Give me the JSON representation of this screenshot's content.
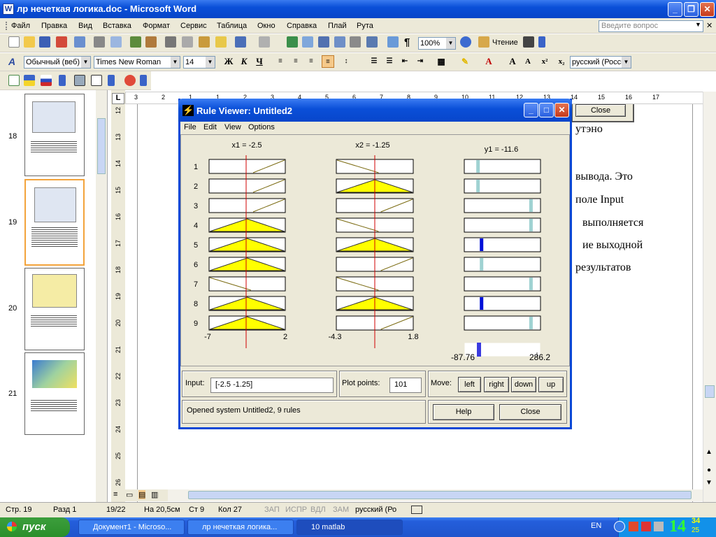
{
  "window": {
    "title": "лр нечеткая логика.doc - Microsoft Word"
  },
  "menu": [
    "Файл",
    "Правка",
    "Вид",
    "Вставка",
    "Формат",
    "Сервис",
    "Таблица",
    "Окно",
    "Справка",
    "Плай",
    "Рута"
  ],
  "search_placeholder": "Введите вопрос",
  "toolbar": {
    "zoom": "100%",
    "read_label": "Чтение",
    "style": "Обычный (веб)",
    "font": "Times New Roman",
    "size": "14",
    "lang": "русский (Росси"
  },
  "thumbnails": [
    "18",
    "19",
    "20",
    "21"
  ],
  "ruler_h_labels": [
    "3",
    "2",
    "1",
    "1",
    "2",
    "3",
    "4",
    "5",
    "6",
    "7",
    "8",
    "9",
    "10",
    "11",
    "12",
    "13",
    "14",
    "15",
    "16",
    "17"
  ],
  "ruler_v_labels": [
    "12",
    "13",
    "14",
    "15",
    "16",
    "17",
    "18",
    "19",
    "20",
    "21",
    "22",
    "23",
    "24",
    "25",
    "26"
  ],
  "doc_lines": [
    "утэно",
    "вывода. Это",
    "поле Input",
    "выполняется",
    "ие выходной",
    "результатов"
  ],
  "doc_close_label": "Close",
  "rule_viewer": {
    "title": "Rule Viewer: Untitled2",
    "menu": [
      "File",
      "Edit",
      "View",
      "Options"
    ],
    "col_titles": [
      "x1 = -2.5",
      "x2 = -1.25",
      "y1 = -11.6"
    ],
    "rule_numbers": [
      "1",
      "2",
      "3",
      "4",
      "5",
      "6",
      "7",
      "8",
      "9"
    ],
    "x1_range": [
      "-7",
      "2"
    ],
    "x2_range": [
      "-4.3",
      "1.8"
    ],
    "y_range": [
      "-87.76",
      "286.2"
    ],
    "input_label": "Input:",
    "input_value": "[-2.5 -1.25]",
    "plot_points_label": "Plot points:",
    "plot_points_value": "101",
    "move_label": "Move:",
    "move_buttons": [
      "left",
      "right",
      "down",
      "up"
    ],
    "status": "Opened system Untitled2, 9 rules",
    "help_label": "Help",
    "close_label": "Close"
  },
  "status_bar": {
    "page": "Стр. 19",
    "section": "Разд 1",
    "pages": "19/22",
    "at": "На 20,5см",
    "line": "Ст 9",
    "col": "Кол 27",
    "rec": "ЗАП",
    "trk": "ИСПР",
    "ext": "ВДЛ",
    "ovr": "ЗАМ",
    "lang": "русский (Ро"
  },
  "taskbar": {
    "start": "пуск",
    "tasks": [
      "Документ1 - Microso...",
      "лр нечеткая логика...",
      "10 matlab"
    ],
    "lang": "EN",
    "clock": "14",
    "clock_min": "34",
    "clock_sec": "25"
  },
  "colors": {
    "xp_blue": "#0a4fd8",
    "mf_fill": "#ffff00",
    "red_line": "#d00000",
    "taskbar_green": "#2b8f2b"
  }
}
